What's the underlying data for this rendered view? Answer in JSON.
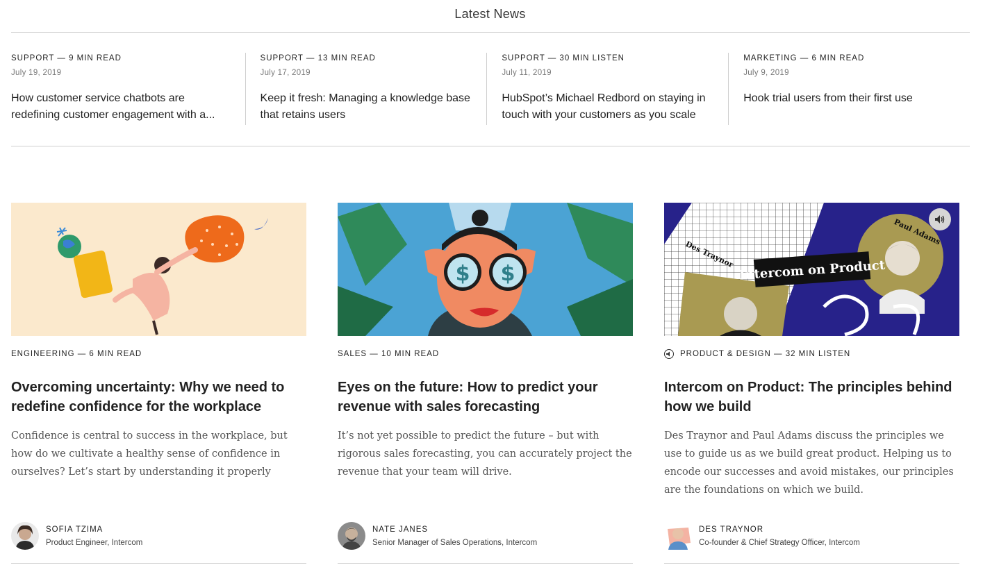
{
  "header": {
    "title": "Latest News"
  },
  "latest_news": [
    {
      "category": "SUPPORT — 9 MIN READ",
      "date": "July 19, 2019",
      "title": "How customer service chatbots are redefining customer engagement with a..."
    },
    {
      "category": "SUPPORT — 13 MIN READ",
      "date": "July 17, 2019",
      "title": "Keep it fresh: Managing a knowledge base that retains users"
    },
    {
      "category": "SUPPORT — 30 MIN LISTEN",
      "date": "July 11, 2019",
      "title": "HubSpot’s Michael Redbord on staying in touch with your customers as you scale"
    },
    {
      "category": "MARKETING — 6 MIN READ",
      "date": "July 9, 2019",
      "title": "Hook trial users from their first use"
    }
  ],
  "cards": [
    {
      "category": "ENGINEERING — 6 MIN READ",
      "title": "Overcoming uncertainty: Why we need to redefine confidence for the workplace",
      "description": "Confidence is central to success in the workplace, but how do we cultivate a healthy sense of confidence in ourselves? Let’s start by understanding it properly",
      "author_name": "SOFIA TZIMA",
      "author_role": "Product Engineer, Intercom"
    },
    {
      "category": "SALES — 10 MIN READ",
      "title": "Eyes on the future: How to predict your revenue with sales forecasting",
      "description": "It’s not yet possible to predict the future – but with rigorous sales forecasting, you can accurately project the revenue that your team will drive.",
      "author_name": "NATE JANES",
      "author_role": "Senior Manager of Sales Operations, Intercom"
    },
    {
      "category": "PRODUCT & DESIGN — 32 MIN LISTEN",
      "title": "Intercom on Product: The principles behind how we build",
      "description": "Des Traynor and Paul Adams discuss the principles we use to guide us as we build great product. Helping us to encode our successes and avoid mistakes, our principles are the foundations on which we build.",
      "author_name": "DES TRAYNOR",
      "author_role": "Co-founder & Chief Strategy Officer, Intercom",
      "image_text": {
        "banner": "Intercom on Product",
        "left_name": "Des Traynor",
        "right_name": "Paul Adams"
      }
    }
  ],
  "colors": {
    "rule": "#cfcfcf",
    "text": "#222222",
    "muted": "#777777",
    "serif_text": "#555555"
  },
  "icons": [
    "speaker-icon"
  ]
}
